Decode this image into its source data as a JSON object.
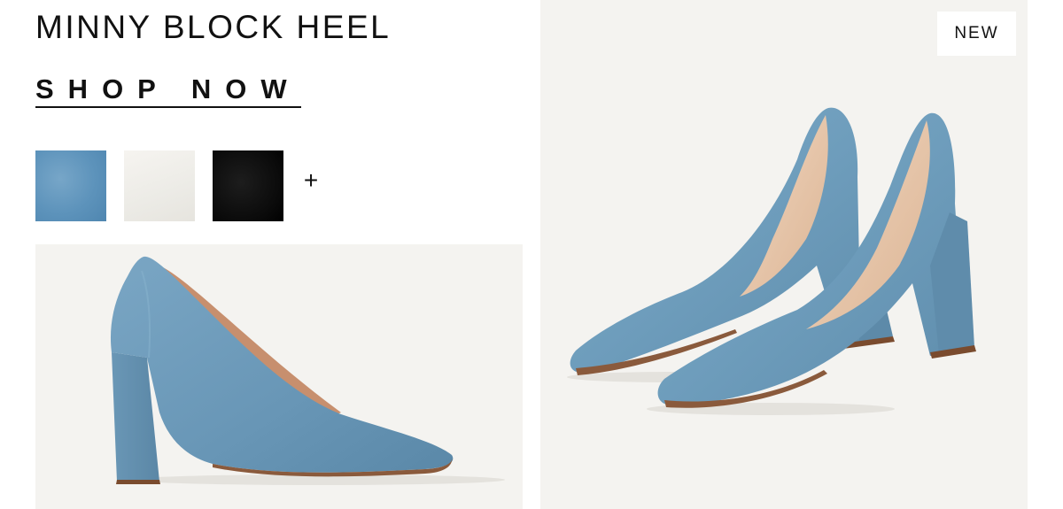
{
  "product": {
    "title": "MINNY BLOCK HEEL",
    "shop_now_label": "SHOP NOW",
    "badge": "NEW"
  },
  "swatches": [
    {
      "name": "blue-suede",
      "color": "#5f95bd"
    },
    {
      "name": "white",
      "color": "#eeece7"
    },
    {
      "name": "black",
      "color": "#0d0d0d"
    }
  ],
  "more_colors_label": "+",
  "colors": {
    "background": "#ffffff",
    "image_background": "#f4f3f0",
    "text": "#111111",
    "shoe_blue": "#6f9dbd",
    "shoe_lining": "#e7c7ad"
  }
}
